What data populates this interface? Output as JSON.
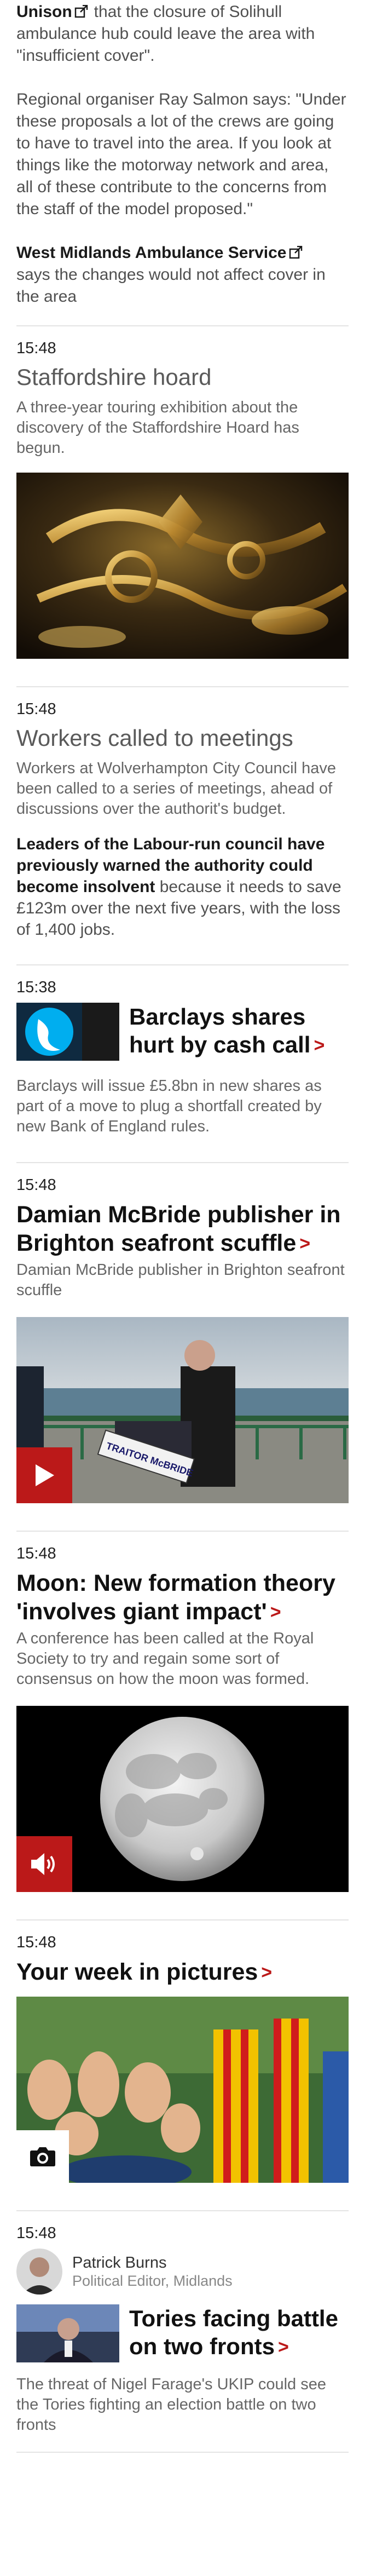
{
  "intro": {
    "unison_link": "Unison",
    "unison_text": "that the closure of Solihull ambulance hub could leave the area with \"insufficient cover\".",
    "quote": "Regional organiser Ray Salmon says: \"Under these proposals a lot of the crews are going to have to travel into the area. If you look at things like the motorway network and area, all of these contribute to the concerns from the staff of the model proposed.\"",
    "wmas_link": "West Midlands Ambulance Service",
    "wmas_text": "says the changes would not affect cover in the area"
  },
  "entries": [
    {
      "time": "15:48",
      "title": "Staffordshire hoard",
      "summary": "A three-year touring exhibition about the discovery of the Staffordshire Hoard has begun."
    },
    {
      "time": "15:48",
      "title": "Workers called to meetings",
      "summary": "Workers at Wolverhampton City Council have been called to a series of meetings, ahead of discussions over the authorit's budget.",
      "body_bold": "Leaders of the Labour-run council have previously warned the authority could become insolvent",
      "body_rest": " because it needs to save £123m over the next five years, with the loss of 1,400 jobs."
    },
    {
      "time": "15:38",
      "title": "Barclays shares hurt by cash call",
      "summary": "Barclays will issue £5.8bn in new shares as part of a move to plug a shortfall created by new Bank of England rules."
    },
    {
      "time": "15:48",
      "title": "Damian McBride publisher in Brighton seafront scuffle",
      "summary": "Damian McBride publisher in Brighton seafront scuffle",
      "placard_text": "TRAITOR McBRIDE"
    },
    {
      "time": "15:48",
      "title": "Moon: New formation theory 'involves giant impact'",
      "summary": "A conference has been called at the Royal Society to try and regain some sort of consensus on how the moon was formed."
    },
    {
      "time": "15:48",
      "title": "Your week in pictures"
    },
    {
      "time": "15:48",
      "author_name": "Patrick Burns",
      "author_role": "Political Editor, Midlands",
      "title": "Tories facing battle on two fronts",
      "summary": "The threat of Nigel Farage's UKIP could see the Tories fighting an election battle on two fronts"
    }
  ],
  "chevron": ">",
  "icons": {
    "external": "external-link-icon",
    "play": "play-icon",
    "audio": "speaker-icon",
    "camera": "camera-icon"
  },
  "colors": {
    "accent": "#bb1919",
    "divider": "#e4e4e4"
  }
}
